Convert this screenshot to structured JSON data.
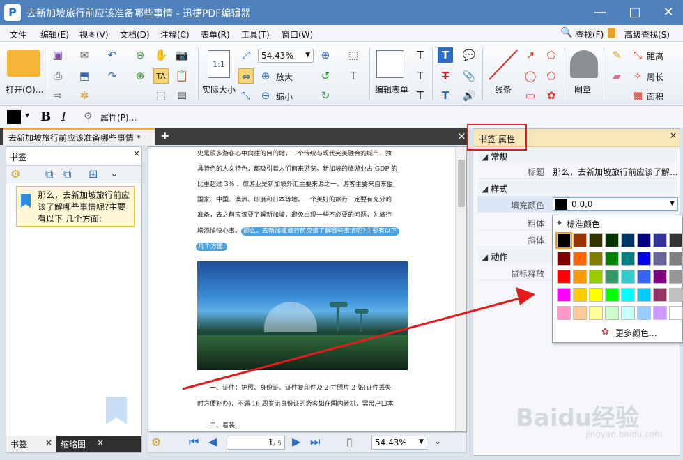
{
  "titlebar": {
    "title": "去新加坡旅行前应该准备哪些事情 - 迅捷PDF编辑器",
    "logo": "P"
  },
  "menubar": {
    "items": [
      "文件",
      "编辑(E)",
      "视图(V)",
      "文档(D)",
      "注释(C)",
      "表单(R)",
      "工具(T)",
      "窗口(W)"
    ],
    "find": "查找(F)",
    "advanced_find": "高级查找(S)"
  },
  "ribbon": {
    "open": "打开(O)...",
    "zoom": "54.43%",
    "actual_size": "实际大小",
    "zoom_in": "放大",
    "zoom_out": "缩小",
    "edit_form": "编辑表单",
    "line": "线条",
    "stamp": "图章",
    "distance": "距离",
    "perimeter": "周长",
    "area": "面积"
  },
  "propbar": {
    "bold": "B",
    "italic": "I",
    "properties": "属性(P)..."
  },
  "tabs": {
    "doc_tab": "去新加坡旅行前应该准备哪些事情 *",
    "add": "+",
    "close": "×"
  },
  "left_panel": {
    "header": "书签",
    "bookmark_text": "那么，去新加坡旅行前应该了解哪些事情呢?主要有以下 几个方面:",
    "bottom_tabs": [
      "书签",
      "缩略图"
    ]
  },
  "document": {
    "lines": [
      "史是很多游客心中向往的目的地，一个传统与现代完美融合的城市，独",
      "具特色的人文特色，都吸引着人们前来游览。新加坡的旅游业占 GDP 的",
      "比重超过 3% ，旅游业是新加坡外汇主要来源之一。游客主要来自东盟",
      "国家、中国、澳洲、印度和日本等地。一个美好的旅行一定要有充分的",
      "准备，去之前应该要了解新加坡，避免出现一些不必要的问题，为旅行"
    ],
    "line6_prefix": "增添愉快心事。",
    "highlight1": "那么，去新加坡旅行前应该了解哪些事情呢?主要有以下",
    "highlight2": "几个方面:",
    "bottom_lines": [
      "一、证件：护照、身份证、证件复印件及 2 寸照片 2 张(证件丢失",
      "时方便补办)，不满 16 周岁无身份证的游客如在国内转机，需带户口本",
      "二、着装:"
    ]
  },
  "bottombar": {
    "page": "1",
    "total": "/ 5",
    "zoom": "54.43%"
  },
  "right_panel": {
    "header_tabs": [
      "书签",
      "属性"
    ],
    "sec_general": "常规",
    "title_label": "标题",
    "title_value": "那么，去新加坡旅行前应该了解...",
    "sec_style": "样式",
    "fill_label": "填充颜色",
    "fill_value": "0,0,0",
    "bold_label": "粗体",
    "italic_label": "斜体",
    "sec_action": "动作",
    "mouse_label": "鼠标释放"
  },
  "color_popup": {
    "title": "标准颜色",
    "more": "更多颜色...",
    "colors": [
      "#000000",
      "#993300",
      "#333300",
      "#003300",
      "#003366",
      "#000080",
      "#333399",
      "#333333",
      "#800000",
      "#ff6600",
      "#808000",
      "#008000",
      "#008080",
      "#0000ff",
      "#666699",
      "#808080",
      "#ff0000",
      "#ff9900",
      "#99cc00",
      "#339966",
      "#33cccc",
      "#3366ff",
      "#800080",
      "#969696",
      "#ff00ff",
      "#ffcc00",
      "#ffff00",
      "#00ff00",
      "#00ffff",
      "#00ccff",
      "#993366",
      "#c0c0c0",
      "#ff99cc",
      "#ffcc99",
      "#ffff99",
      "#ccffcc",
      "#ccffff",
      "#99ccff",
      "#cc99ff",
      "#ffffff"
    ]
  },
  "watermark": {
    "main": "Baidu经验",
    "sub": "jingyan.baidu.com"
  }
}
